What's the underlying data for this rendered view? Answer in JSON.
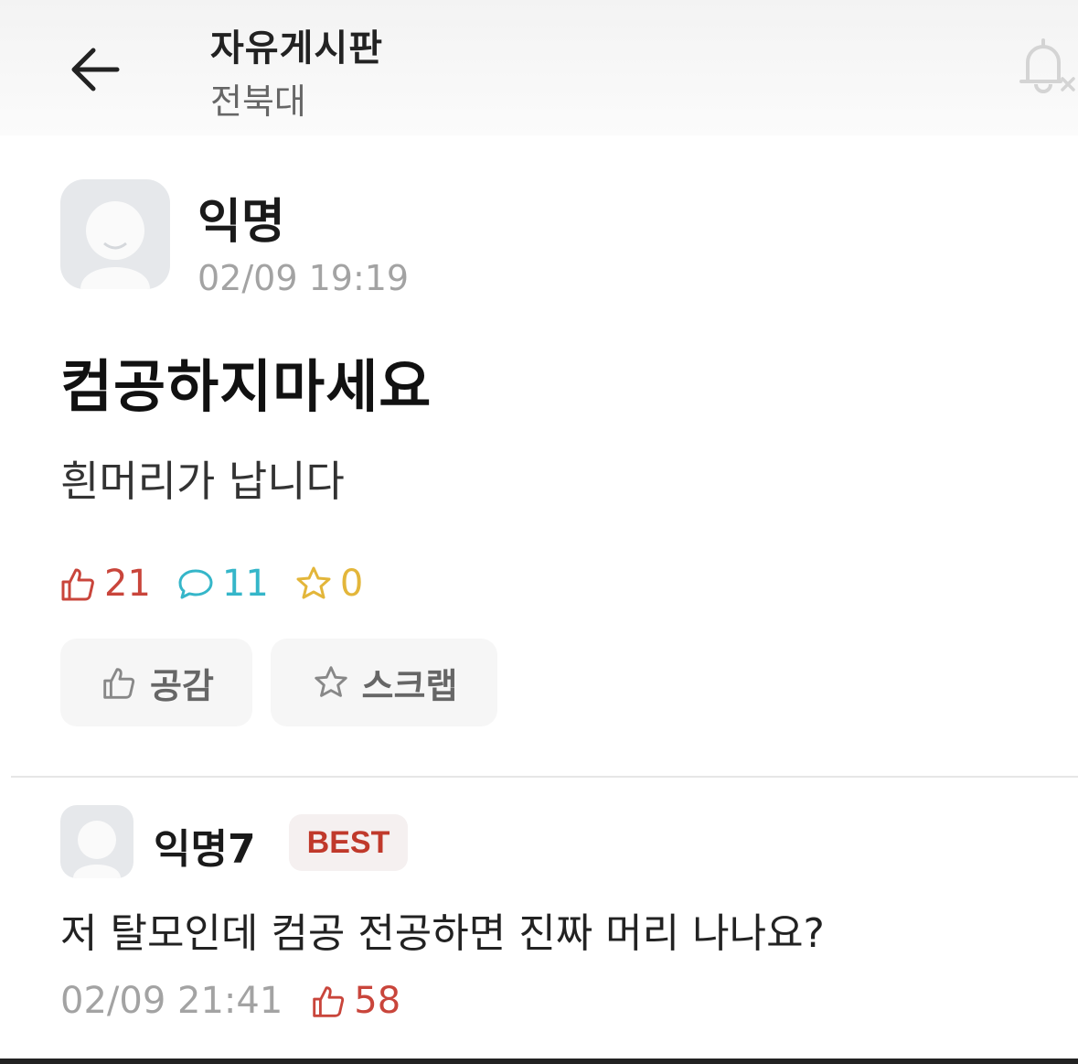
{
  "header": {
    "title": "자유게시판",
    "subtitle": "전북대"
  },
  "post": {
    "author": "익명",
    "time": "02/09 19:19",
    "title": "컴공하지마세요",
    "body": "흰머리가 납니다",
    "stats": {
      "likes": "21",
      "comments": "11",
      "scraps": "0"
    },
    "actions": {
      "like_label": "공감",
      "scrap_label": "스크랩"
    }
  },
  "comment": {
    "author": "익명7",
    "badge": "BEST",
    "text": "저 탈모인데 컴공 전공하면 진짜 머리 나나요?",
    "time": "02/09 21:41",
    "likes": "58"
  },
  "colors": {
    "like": "#c9453b",
    "comment": "#35b6c9",
    "scrap": "#e3b63a",
    "best": "#c0392b"
  },
  "icons": [
    "back-arrow-icon",
    "bell-off-icon",
    "thumbs-up-icon",
    "speech-bubble-icon",
    "star-icon",
    "avatar-icon"
  ]
}
